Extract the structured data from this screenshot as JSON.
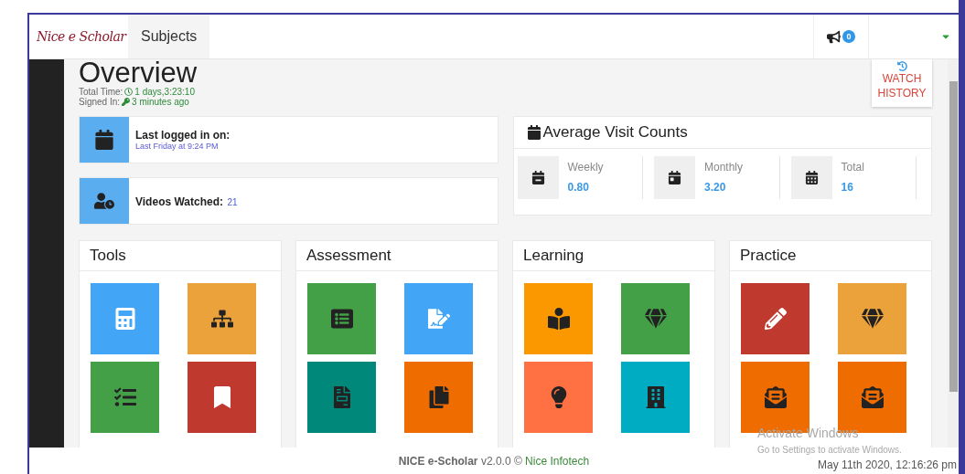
{
  "header": {
    "logo": "Nice e Scholar",
    "menu": [
      {
        "label": "Subjects"
      }
    ],
    "notification_count": "0"
  },
  "overview": {
    "title": "Overview",
    "total_time_label": "Total Time:",
    "total_time": "1 days,3:23:10",
    "signed_in_label": "Signed In:",
    "signed_in": "3 minutes ago",
    "watch_history": "WATCH HISTORY"
  },
  "last_login": {
    "label": "Last logged in on:",
    "value": "Last Friday at 9:24 PM"
  },
  "videos": {
    "label": "Videos Watched:",
    "value": "21"
  },
  "visits": {
    "title": "Average Visit Counts",
    "stats": [
      {
        "label": "Weekly",
        "value": "0.80"
      },
      {
        "label": "Monthly",
        "value": "3.20"
      },
      {
        "label": "Total",
        "value": "16"
      }
    ]
  },
  "sections": [
    {
      "title": "Tools",
      "tiles": [
        {
          "color": "#42a5f5"
        },
        {
          "color": "#eca23a"
        },
        {
          "color": "#43a047"
        },
        {
          "color": "#c0392f"
        }
      ]
    },
    {
      "title": "Assessment",
      "tiles": [
        {
          "color": "#43a047"
        },
        {
          "color": "#42a5f5"
        },
        {
          "color": "#00897b"
        },
        {
          "color": "#ef6c00"
        }
      ]
    },
    {
      "title": "Learning",
      "tiles": [
        {
          "color": "#fb9800"
        },
        {
          "color": "#43a047"
        },
        {
          "color": "#ff7043"
        },
        {
          "color": "#00acc1"
        }
      ]
    },
    {
      "title": "Practice",
      "tiles": [
        {
          "color": "#c0392f"
        },
        {
          "color": "#eca23a"
        },
        {
          "color": "#ef6c00"
        },
        {
          "color": "#ef6c00"
        }
      ]
    }
  ],
  "os_notice": {
    "title": "Activate Windows",
    "text": "Go to Settings to activate Windows."
  },
  "footer": {
    "product": "NICE e-Scholar",
    "version": "v2.0.0 ©",
    "company": "Nice Infotech",
    "datetime": "May 11th 2020, 12:16:26 pm"
  }
}
